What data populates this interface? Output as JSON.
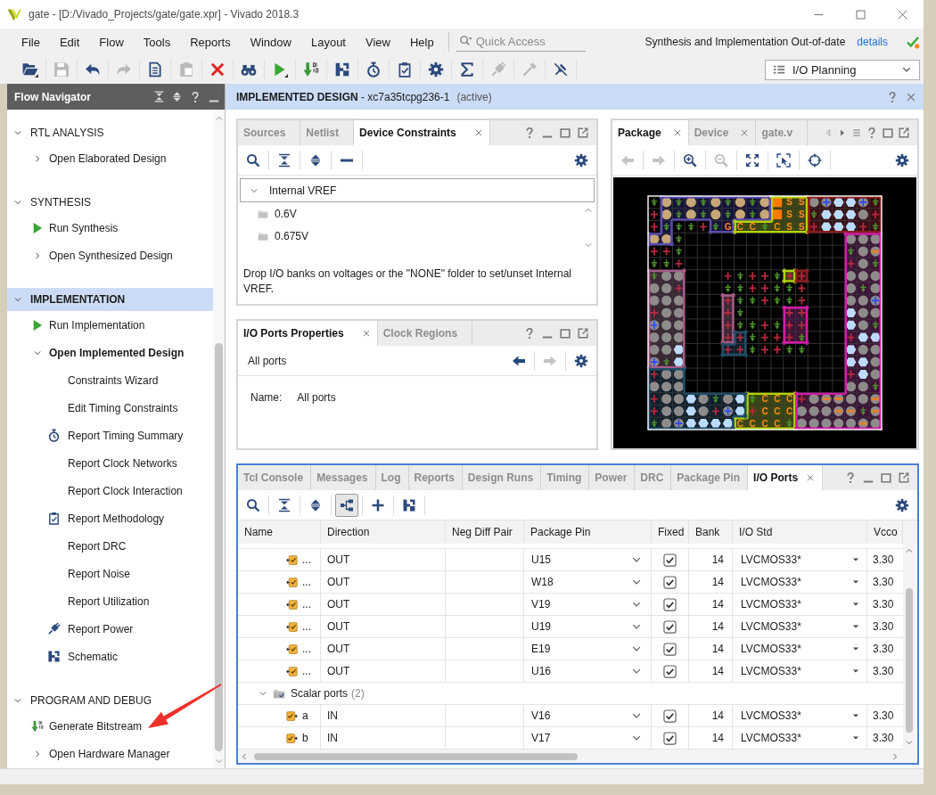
{
  "window": {
    "title": "gate - [D:/Vivado_Projects/gate/gate.xpr] - Vivado 2018.3"
  },
  "menu": [
    "File",
    "Edit",
    "Flow",
    "Tools",
    "Reports",
    "Window",
    "Layout",
    "View",
    "Help"
  ],
  "quick_access": {
    "placeholder": "Quick Access"
  },
  "status": {
    "message": "Synthesis and Implementation Out-of-date",
    "link": "details"
  },
  "toolbar": [
    {
      "kind": "open",
      "disabled": false
    },
    {
      "kind": "save",
      "disabled": true
    },
    {
      "kind": "undo",
      "disabled": false
    },
    {
      "kind": "redo",
      "disabled": true
    },
    {
      "kind": "copy",
      "disabled": false
    },
    {
      "kind": "paste",
      "disabled": true
    },
    {
      "kind": "delete",
      "disabled": false
    },
    {
      "kind": "find",
      "disabled": false
    },
    {
      "kind": "run",
      "disabled": false
    },
    {
      "kind": "bitstream",
      "disabled": false
    },
    {
      "kind": "schematic",
      "disabled": false
    },
    {
      "kind": "timing",
      "disabled": false
    },
    {
      "kind": "methodology",
      "disabled": false
    },
    {
      "kind": "settings",
      "disabled": false
    },
    {
      "kind": "sum",
      "disabled": false
    },
    {
      "kind": "power",
      "disabled": true
    },
    {
      "kind": "probe",
      "disabled": true
    },
    {
      "kind": "unpin",
      "disabled": false
    }
  ],
  "layout_selector": {
    "value": "I/O Planning"
  },
  "flow_navigator": {
    "title": "Flow Navigator",
    "sections": [
      {
        "label": "RTL ANALYSIS",
        "expanded": true,
        "selected": false,
        "items": [
          {
            "label": "Open Elaborated Design",
            "kind": "group",
            "expanded": false
          }
        ]
      },
      {
        "label": "SYNTHESIS",
        "expanded": true,
        "selected": false,
        "items": [
          {
            "label": "Run Synthesis",
            "kind": "run"
          },
          {
            "label": "Open Synthesized Design",
            "kind": "group",
            "expanded": false
          }
        ]
      },
      {
        "label": "IMPLEMENTATION",
        "expanded": true,
        "selected": true,
        "items": [
          {
            "label": "Run Implementation",
            "kind": "run"
          },
          {
            "label": "Open Implemented Design",
            "kind": "group",
            "expanded": true,
            "children": [
              {
                "label": "Constraints Wizard",
                "kind": "action"
              },
              {
                "label": "Edit Timing Constraints",
                "kind": "action"
              },
              {
                "label": "Report Timing Summary",
                "kind": "timing"
              },
              {
                "label": "Report Clock Networks",
                "kind": "action"
              },
              {
                "label": "Report Clock Interaction",
                "kind": "action"
              },
              {
                "label": "Report Methodology",
                "kind": "methodology"
              },
              {
                "label": "Report DRC",
                "kind": "action"
              },
              {
                "label": "Report Noise",
                "kind": "action"
              },
              {
                "label": "Report Utilization",
                "kind": "action"
              },
              {
                "label": "Report Power",
                "kind": "power"
              },
              {
                "label": "Schematic",
                "kind": "schematic"
              }
            ]
          }
        ]
      },
      {
        "label": "PROGRAM AND DEBUG",
        "expanded": true,
        "selected": false,
        "items": [
          {
            "label": "Generate Bitstream",
            "kind": "bitstream"
          },
          {
            "label": "Open Hardware Manager",
            "kind": "group",
            "expanded": false
          }
        ]
      }
    ]
  },
  "design_header": {
    "title": "**IMPLEMENTED DESIGN** - xc7a35tcpg236-1",
    "note": "(active)"
  },
  "constraints_panel": {
    "tabs": [
      {
        "label": "Sources",
        "selected": false,
        "closable": false
      },
      {
        "label": "Netlist",
        "selected": false,
        "closable": false
      },
      {
        "label": "Device Constraints",
        "selected": true,
        "closable": true
      }
    ],
    "toolbar": [
      {
        "kind": "search",
        "disabled": false
      },
      {
        "kind": "collapse",
        "disabled": false
      },
      {
        "kind": "expand",
        "disabled": false
      },
      {
        "kind": "remove",
        "disabled": false
      },
      {
        "kind": "settings",
        "disabled": false
      }
    ],
    "tree": [
      {
        "label": "Internal VREF",
        "expanded": true,
        "selected": true,
        "children": [
          {
            "label": "0.6V",
            "selected": false
          },
          {
            "label": "0.675V",
            "selected": false
          }
        ]
      }
    ],
    "hint": "Drop I/O banks on voltages or the \"NONE\" folder to set/unset Internal VREF."
  },
  "properties_panel": {
    "tabs": [
      {
        "label": "I/O Ports Properties",
        "selected": true,
        "closable": true
      },
      {
        "label": "Clock Regions",
        "selected": false,
        "closable": false
      }
    ],
    "object": "All ports",
    "toolbar": [
      {
        "kind": "back",
        "disabled": false
      },
      {
        "kind": "forward",
        "disabled": true
      },
      {
        "kind": "settings",
        "disabled": false
      }
    ],
    "fields": [
      {
        "label": "Name:",
        "value": "All ports"
      }
    ]
  },
  "package_panel": {
    "tabs": [
      {
        "label": "Package",
        "selected": true,
        "closable": true
      },
      {
        "label": "Device",
        "selected": false,
        "closable": true
      },
      {
        "label": "gate.v",
        "selected": false,
        "closable": false
      }
    ],
    "toolbar": [
      {
        "kind": "back",
        "disabled": true
      },
      {
        "kind": "forward",
        "disabled": true
      },
      {
        "kind": "zoom_in",
        "disabled": false
      },
      {
        "kind": "zoom_out",
        "disabled": true
      },
      {
        "kind": "fit",
        "disabled": false
      },
      {
        "kind": "select_area",
        "disabled": false
      },
      {
        "kind": "crosshair",
        "disabled": false
      },
      {
        "kind": "settings",
        "disabled": false
      }
    ],
    "pin_labels": [
      "S",
      "S",
      "S",
      "S",
      "G",
      "C",
      "C",
      "C",
      "S",
      "S",
      "C",
      "C",
      "C",
      "C",
      "C",
      "C",
      "C",
      "C",
      "C",
      "C"
    ]
  },
  "io_ports_panel": {
    "tabs": [
      {
        "label": "Tcl Console",
        "selected": false,
        "closable": false
      },
      {
        "label": "Messages",
        "selected": false,
        "closable": false
      },
      {
        "label": "Log",
        "selected": false,
        "closable": false
      },
      {
        "label": "Reports",
        "selected": false,
        "closable": false
      },
      {
        "label": "Design Runs",
        "selected": false,
        "closable": false
      },
      {
        "label": "Timing",
        "selected": false,
        "closable": false
      },
      {
        "label": "Power",
        "selected": false,
        "closable": false
      },
      {
        "label": "DRC",
        "selected": false,
        "closable": false
      },
      {
        "label": "Package Pin",
        "selected": false,
        "closable": false
      },
      {
        "label": "I/O Ports",
        "selected": true,
        "closable": true
      }
    ],
    "toolbar": [
      {
        "kind": "search",
        "pressed": false
      },
      {
        "kind": "collapse",
        "pressed": false
      },
      {
        "kind": "expand",
        "pressed": false
      },
      {
        "kind": "hierarchy",
        "pressed": true
      },
      {
        "kind": "add",
        "pressed": false
      },
      {
        "kind": "schematic",
        "pressed": false
      },
      {
        "kind": "settings",
        "pressed": false
      }
    ],
    "columns": [
      "Name",
      "Direction",
      "Neg Diff Pair",
      "Package Pin",
      "Fixed",
      "Bank",
      "I/O Std",
      "Vcco"
    ],
    "rows": [
      {
        "kind": "output_port",
        "name": "...",
        "direction": "OUT",
        "package_pin": "U15",
        "fixed": true,
        "bank": "14",
        "io_std": "LVCMOS33*",
        "vcco": "3.30"
      },
      {
        "kind": "output_port",
        "name": "...",
        "direction": "OUT",
        "package_pin": "W18",
        "fixed": true,
        "bank": "14",
        "io_std": "LVCMOS33*",
        "vcco": "3.30"
      },
      {
        "kind": "output_port",
        "name": "...",
        "direction": "OUT",
        "package_pin": "V19",
        "fixed": true,
        "bank": "14",
        "io_std": "LVCMOS33*",
        "vcco": "3.30"
      },
      {
        "kind": "output_port",
        "name": "...",
        "direction": "OUT",
        "package_pin": "U19",
        "fixed": true,
        "bank": "14",
        "io_std": "LVCMOS33*",
        "vcco": "3.30"
      },
      {
        "kind": "output_port",
        "name": "...",
        "direction": "OUT",
        "package_pin": "E19",
        "fixed": true,
        "bank": "14",
        "io_std": "LVCMOS33*",
        "vcco": "3.30"
      },
      {
        "kind": "output_port",
        "name": "...",
        "direction": "OUT",
        "package_pin": "U16",
        "fixed": true,
        "bank": "14",
        "io_std": "LVCMOS33*",
        "vcco": "3.30"
      },
      {
        "kind": "group",
        "name": "Scalar ports",
        "count": "(2)",
        "expanded": true
      },
      {
        "kind": "input_port",
        "name": "a",
        "direction": "IN",
        "package_pin": "V16",
        "fixed": true,
        "bank": "14",
        "io_std": "LVCMOS33*",
        "vcco": "3.30"
      },
      {
        "kind": "input_port",
        "name": "b",
        "direction": "IN",
        "package_pin": "V17",
        "fixed": true,
        "bank": "14",
        "io_std": "LVCMOS33*",
        "vcco": "3.30"
      }
    ]
  }
}
